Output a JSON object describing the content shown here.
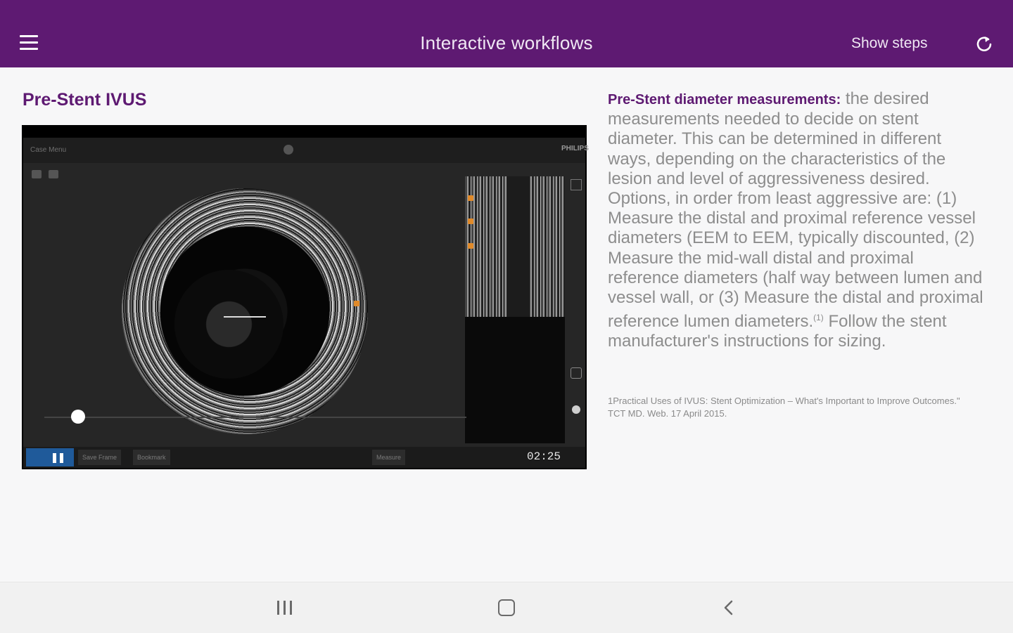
{
  "header": {
    "title": "Interactive workflows",
    "show_steps_label": "Show steps",
    "icons": [
      "hamburger-menu-icon",
      "refresh-icon"
    ]
  },
  "page": {
    "title": "Pre-Stent IVUS"
  },
  "video": {
    "case_menu_label": "Case Menu",
    "brand": "PHILIPS",
    "time": "02:25",
    "save_frame_label": "Save Frame",
    "bookmark_label": "Bookmark",
    "measure_label": "Measure",
    "progress": 0.08
  },
  "description": {
    "heading": "Pre-Stent diameter measurements:",
    "body": " the desired measurements needed to decide on stent diameter. This can be determined in different ways, depending on the characteristics of the lesion and level of aggressiveness desired. Options, in order from least aggressive are: (1) Measure the distal and proximal reference vessel diameters (EEM to EEM, typically discounted, (2) Measure the mid-wall distal and proximal reference diameters (half way between lumen and vessel wall, or (3) Measure the distal and proximal reference lumen diameters.",
    "superscript": "(1)",
    "tail": " Follow the stent manufacturer's instructions for sizing."
  },
  "reference": {
    "text": "1Practical Uses of IVUS: Stent Optimization – What's Important to Improve Outcomes.\" TCT MD. Web. 17 April 2015."
  },
  "navbar": {
    "icons": [
      "recent-apps-icon",
      "home-icon",
      "back-icon"
    ]
  }
}
